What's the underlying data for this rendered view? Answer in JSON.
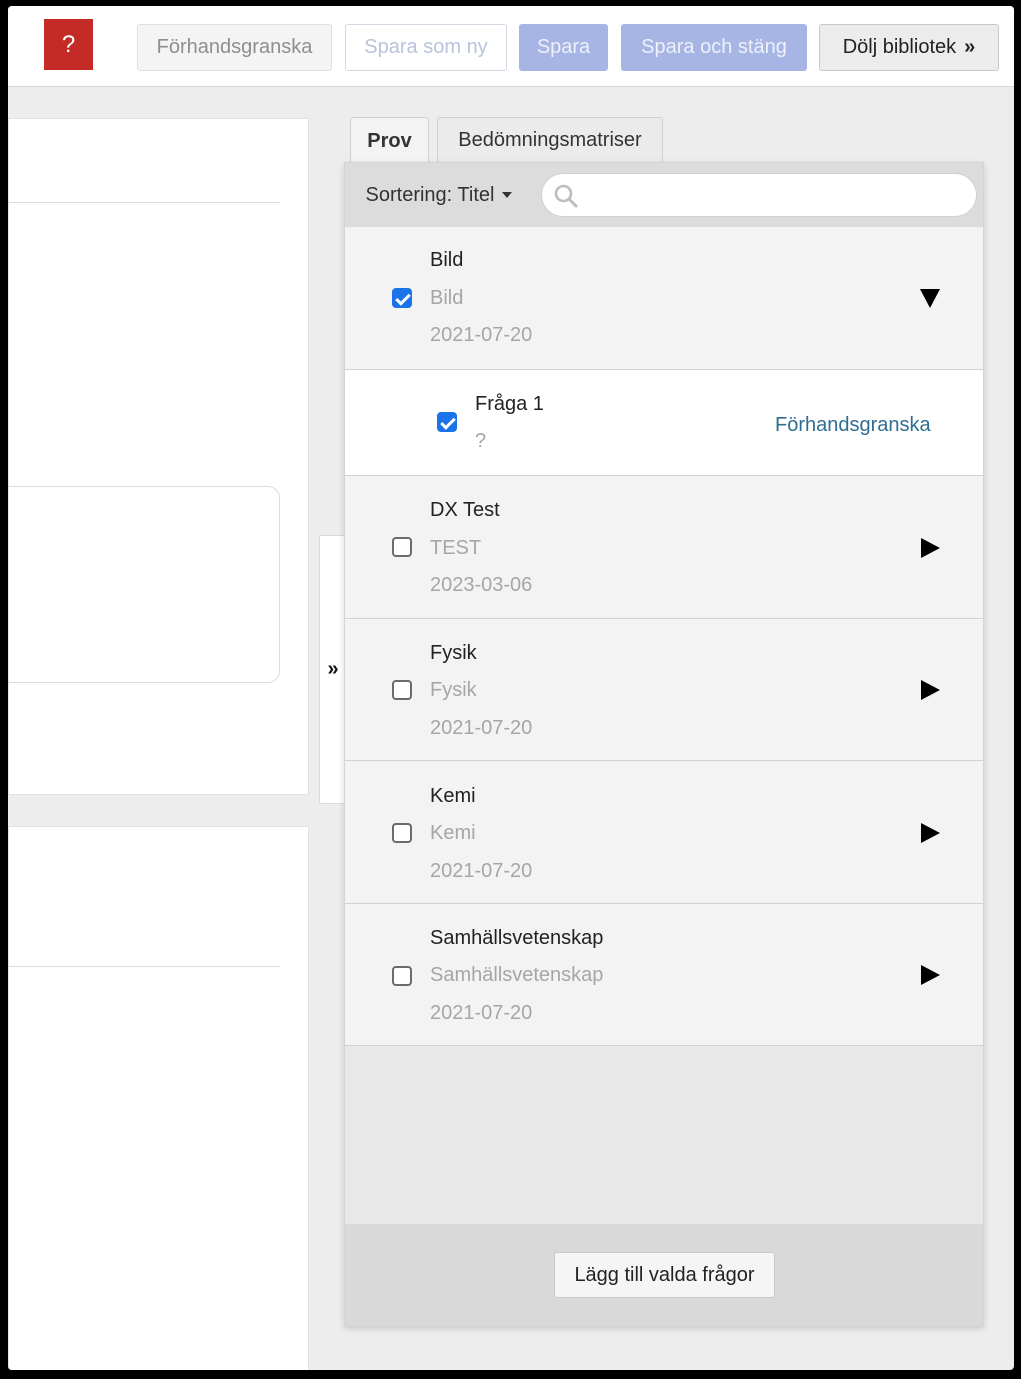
{
  "toolbar": {
    "help_label": "?",
    "preview_label": "Förhandsgranska",
    "save_as_new_label": "Spara som ny",
    "save_label": "Spara",
    "save_close_label": "Spara och stäng",
    "hide_library_label": "Dölj bibliotek",
    "hide_library_icon": "»",
    "accent_red": "#c42b26",
    "accent_blue_disabled": "#a6b5e4"
  },
  "collapse_handle": {
    "icon": "»"
  },
  "library": {
    "tabs": [
      {
        "label": "Prov",
        "active": true
      },
      {
        "label": "Bedömningsmatriser",
        "active": false
      }
    ],
    "sort_label": "Sortering: Titel",
    "search": {
      "placeholder": "",
      "value": ""
    },
    "items": [
      {
        "type": "group",
        "title": "Bild",
        "subtitle": "Bild",
        "date": "2021-07-20",
        "checked": true,
        "expanded": true
      },
      {
        "type": "question",
        "title": "Fråga 1",
        "subtitle": "?",
        "checked": true,
        "link": "Förhandsgranska"
      },
      {
        "type": "group",
        "title": "DX Test",
        "subtitle": "TEST",
        "date": "2023-03-06",
        "checked": false,
        "expanded": false
      },
      {
        "type": "group",
        "title": "Fysik",
        "subtitle": "Fysik",
        "date": "2021-07-20",
        "checked": false,
        "expanded": false
      },
      {
        "type": "group",
        "title": "Kemi",
        "subtitle": "Kemi",
        "date": "2021-07-20",
        "checked": false,
        "expanded": false
      },
      {
        "type": "group",
        "title": "Samhällsvetenskap",
        "subtitle": "Samhällsvetenskap",
        "date": "2021-07-20",
        "checked": false,
        "expanded": false
      }
    ],
    "add_selected_label": "Lägg till valda frågor"
  }
}
